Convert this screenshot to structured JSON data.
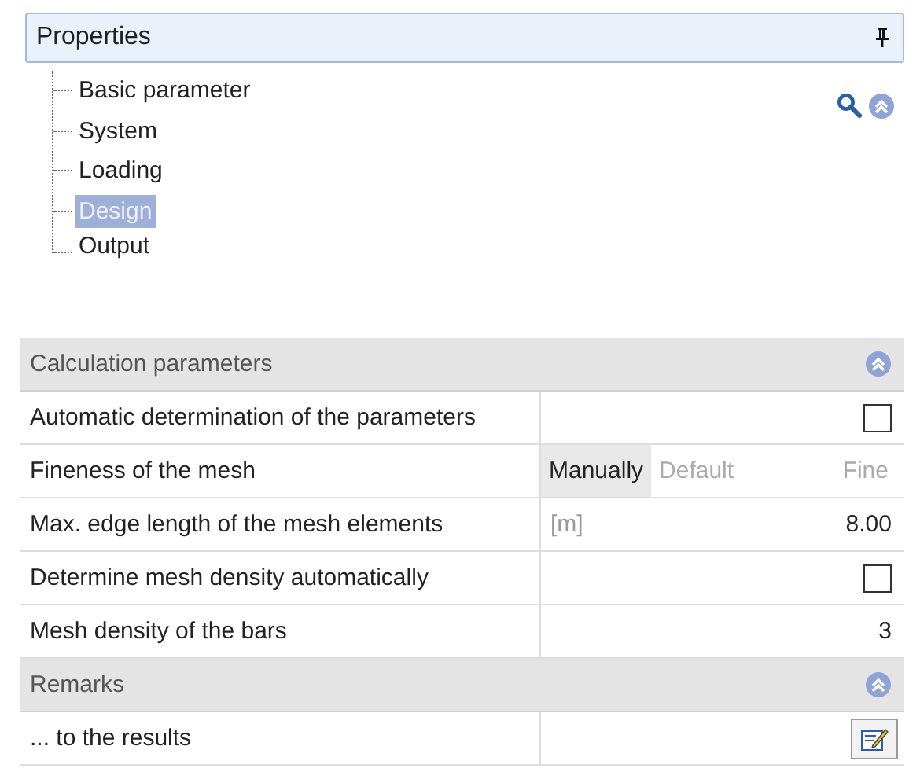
{
  "panel": {
    "title": "Properties"
  },
  "tree": [
    {
      "label": "Basic parameter",
      "selected": false
    },
    {
      "label": "System",
      "selected": false
    },
    {
      "label": "Loading",
      "selected": false
    },
    {
      "label": "Design",
      "selected": true
    },
    {
      "label": "Output",
      "selected": false
    }
  ],
  "sections": [
    {
      "title": "Calculation parameters",
      "expanded": true,
      "rows": [
        {
          "kind": "checkbox",
          "label": "Automatic determination of the parameters",
          "checked": false
        },
        {
          "kind": "options",
          "label": "Fineness of the mesh",
          "options": [
            {
              "label": "Manually",
              "selected": true
            },
            {
              "label": "Default",
              "selected": false
            },
            {
              "label": "Fine",
              "selected": false
            }
          ]
        },
        {
          "kind": "number",
          "label": "Max. edge length of the mesh elements",
          "unit": "[m]",
          "value": "8.00"
        },
        {
          "kind": "checkbox",
          "label": "Determine mesh density automatically",
          "checked": false
        },
        {
          "kind": "number",
          "label": "Mesh density of the bars",
          "value": "3"
        }
      ]
    },
    {
      "title": "Remarks",
      "expanded": true,
      "rows": [
        {
          "kind": "edit",
          "label": "... to the results"
        }
      ]
    }
  ]
}
